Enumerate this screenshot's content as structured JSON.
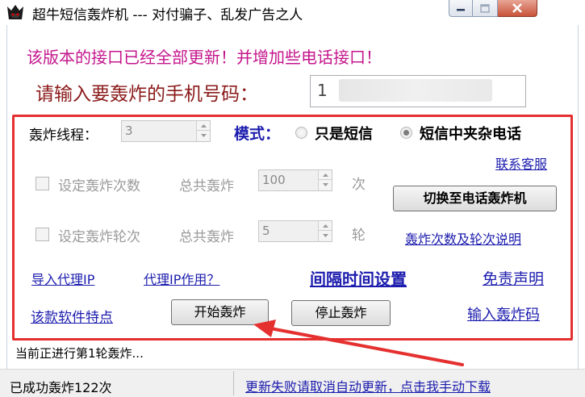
{
  "window": {
    "title": "超牛短信轰炸机 --- 对付骗子、乱发广告之人"
  },
  "notice": "该版本的接口已经全部更新！并增加些电话接口！",
  "phone": {
    "label": "请输入要轰炸的手机号码：",
    "value": "1",
    "partially_obscured": true
  },
  "threads": {
    "label": "轰炸线程：",
    "value": "3"
  },
  "mode": {
    "label": "模式：",
    "options": [
      {
        "label": "只是短信",
        "selected": false
      },
      {
        "label": "短信中夹杂电话",
        "selected": true
      }
    ]
  },
  "links": {
    "contact": "联系客服",
    "explain": "轰炸次数及轮次说明",
    "import_proxy": "导入代理IP",
    "proxy_help": "代理IP作用？",
    "interval": "间隔时间设置",
    "disclaimer": "免责声明",
    "features": "该款软件特点",
    "enter_code": "输入轰炸码",
    "manual_update": "更新失败请取消自动更新，点击我手动下载"
  },
  "count": {
    "checkbox_label": "设定轰炸次数",
    "checked": false,
    "total_label": "总共轰炸",
    "value": "100",
    "unit": "次"
  },
  "rounds": {
    "checkbox_label": "设定轰炸轮次",
    "checked": false,
    "total_label": "总共轰炸",
    "value": "5",
    "unit": "轮"
  },
  "buttons": {
    "switch_call": "切换至电话轰炸机",
    "start": "开始轰炸",
    "stop": "停止轰炸"
  },
  "status_text": "当前正进行第1轮轰炸...",
  "statusbar": {
    "left": "已成功轰炸122次"
  },
  "colors": {
    "notice": "#c4168c",
    "phone_label": "#8b1a1a",
    "link": "#1c1cae",
    "highlight_box": "#e53030",
    "annotation_arrow": "#e53030"
  }
}
